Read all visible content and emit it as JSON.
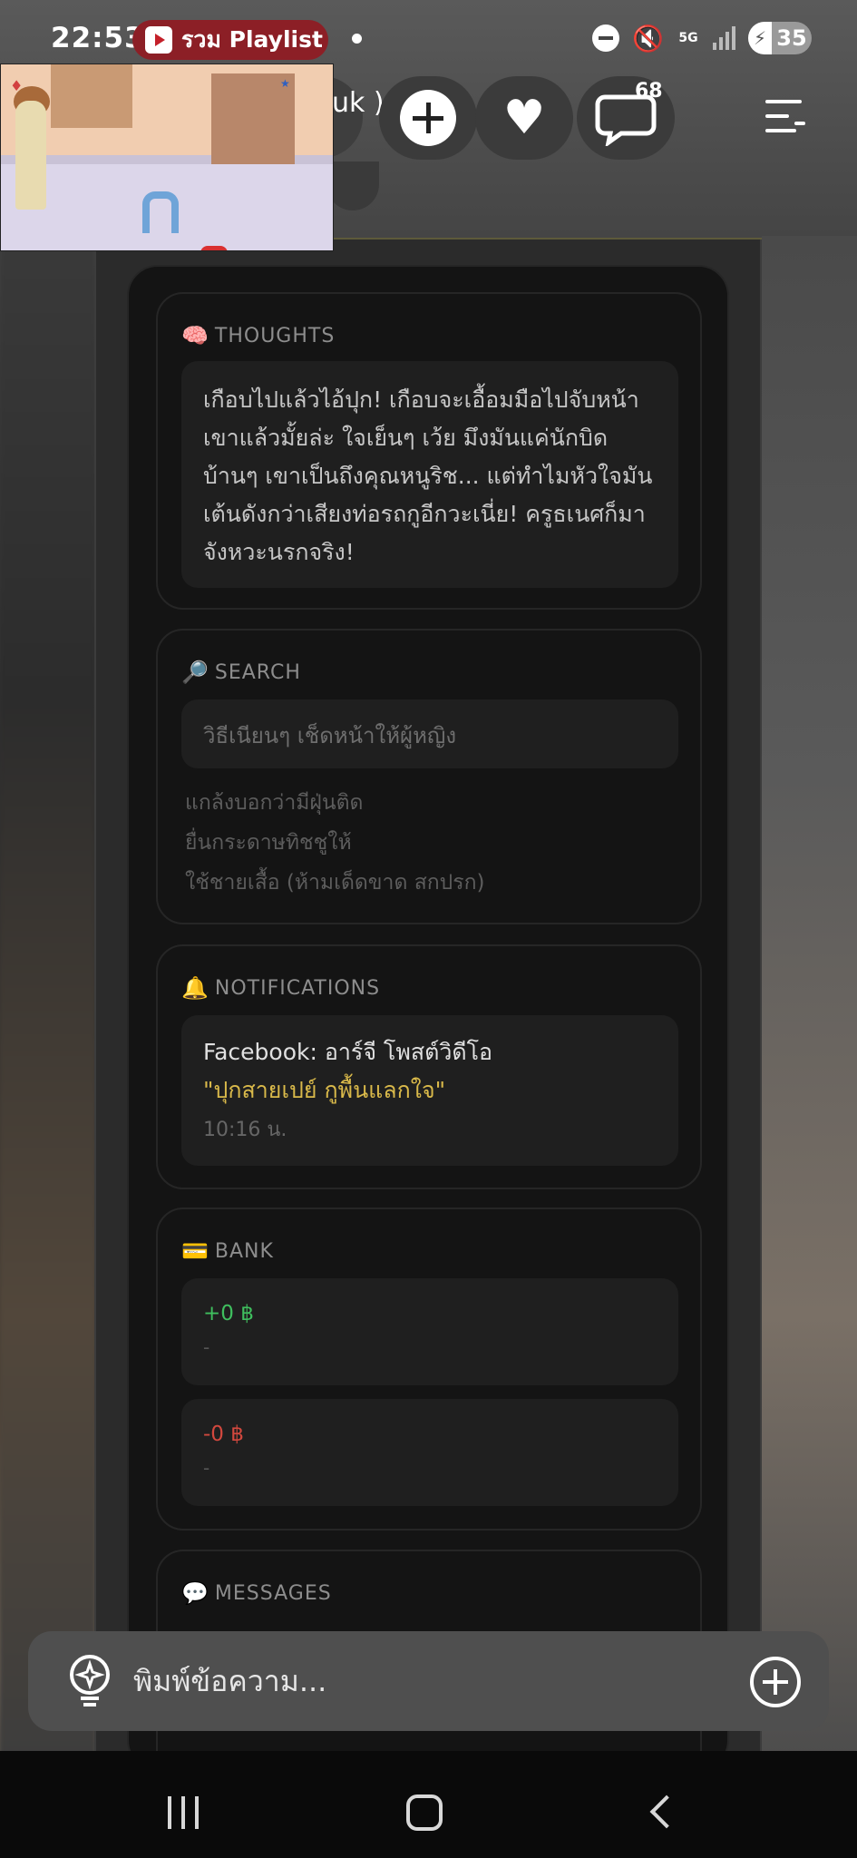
{
  "status_bar": {
    "time": "22:53",
    "playlist_label": "รวม Playlist",
    "network": "5G",
    "battery_level": "35"
  },
  "header": {
    "user_text": "uk )",
    "chat_badge": "68"
  },
  "thoughts": {
    "icon": "brain-icon",
    "title": "THOUGHTS",
    "text": "เกือบไปแล้วไอ้ปุก! เกือบจะเอื้อมมือไปจับหน้าเขาแล้วมั้ยล่ะ ใจเย็นๆ เว้ย มึงมันแค่นักบิดบ้านๆ เขาเป็นถึงคุณหนูริช... แต่ทำไมหัวใจมันเต้นดังกว่าเสียงท่อรถกูอีกวะเนี่ย! ครูธเนศก็มาจังหวะนรกจริง!"
  },
  "search": {
    "icon": "magnifier-icon",
    "title": "SEARCH",
    "query": "วิธีเนียนๆ เช็ดหน้าให้ผู้หญิง",
    "suggestions": [
      "แกล้งบอกว่ามีฝุ่นติด",
      "ยื่นกระดาษทิชชูให้",
      "ใช้ชายเสื้อ (ห้ามเด็ดขาด สกปรก)"
    ]
  },
  "notifications": {
    "icon": "bell-icon",
    "title": "NOTIFICATIONS",
    "source_line": "Facebook: อาร์จี โพสต์วิดีโอ",
    "highlight_line": "\"ปุกสายเปย์ กูพื้นแลกใจ\"",
    "time": "10:16 น."
  },
  "bank": {
    "icon": "credit-card-icon",
    "title": "BANK",
    "incoming": {
      "amount": "+0 ฿",
      "note": "-"
    },
    "outgoing": {
      "amount": "-0 ฿",
      "note": "-"
    }
  },
  "messages": {
    "icon": "speech-bubble-icon",
    "title": "MESSAGES"
  },
  "composer": {
    "placeholder": "พิมพ์ข้อความ..."
  },
  "colors": {
    "incoming_amount": "#3fbf5e",
    "outgoing_amount": "#d2483e",
    "highlight_text": "#d9b94a",
    "playlist_pill": "#8c1f26"
  }
}
